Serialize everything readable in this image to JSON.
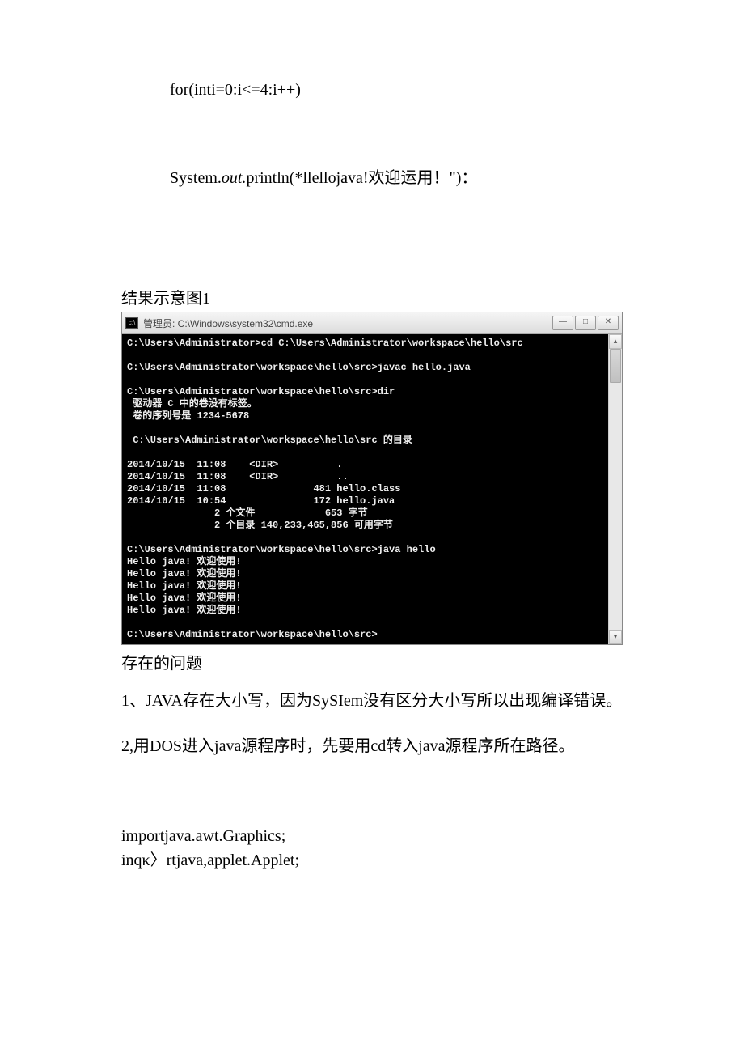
{
  "code1": "for(inti=0:i<=4:i++)",
  "code2_pre": "System.",
  "code2_em": "out.",
  "code2_post": "println(*llellojava!欢迎运用！\")：",
  "heading1": "结果示意图1",
  "terminal": {
    "title_prefix": "管理员:",
    "title_path": " C:\\Windows\\system32\\cmd.exe",
    "lines": [
      "C:\\Users\\Administrator>cd C:\\Users\\Administrator\\workspace\\hello\\src",
      "",
      "C:\\Users\\Administrator\\workspace\\hello\\src>javac hello.java",
      "",
      "C:\\Users\\Administrator\\workspace\\hello\\src>dir",
      " 驱动器 C 中的卷没有标签。",
      " 卷的序列号是 1234-5678",
      "",
      " C:\\Users\\Administrator\\workspace\\hello\\src 的目录",
      "",
      "2014/10/15  11:08    <DIR>          .",
      "2014/10/15  11:08    <DIR>          ..",
      "2014/10/15  11:08               481 hello.class",
      "2014/10/15  10:54               172 hello.java",
      "               2 个文件            653 字节",
      "               2 个目录 140,233,465,856 可用字节",
      "",
      "C:\\Users\\Administrator\\workspace\\hello\\src>java hello",
      "Hello java! 欢迎使用!",
      "Hello java! 欢迎使用!",
      "Hello java! 欢迎使用!",
      "Hello java! 欢迎使用!",
      "Hello java! 欢迎使用!",
      "",
      "C:\\Users\\Administrator\\workspace\\hello\\src>"
    ]
  },
  "section_problems": "存在的问题",
  "problem1": "1、JAVA存在大小写，因为SySIem没有区分大小写所以出现编译错误。",
  "problem2": "2,用DOS进入java源程序时，先要用cd转入java源程序所在路径。",
  "import1": "importjava.awt.Graphics;",
  "import2": "  inqκ〉rtjava,applet.Applet;"
}
